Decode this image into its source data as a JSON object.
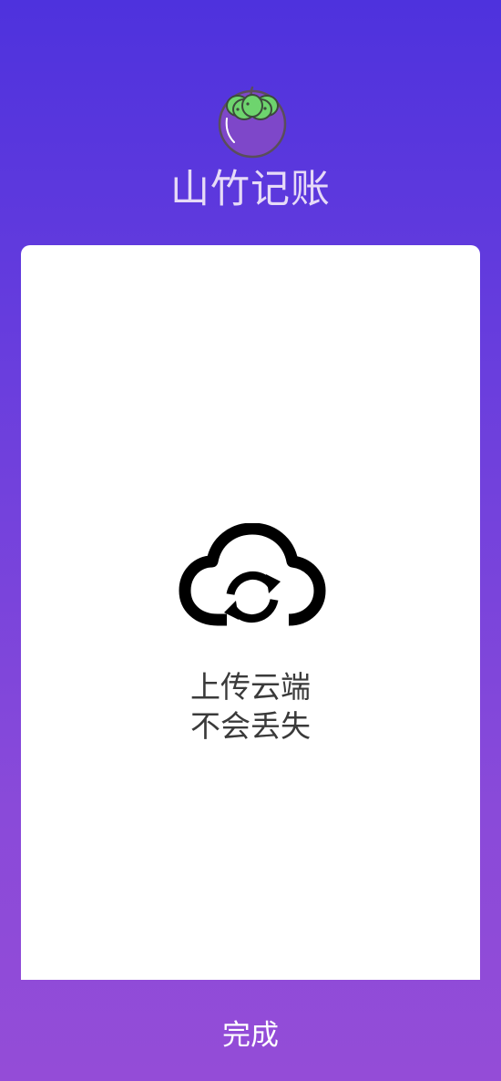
{
  "app": {
    "title": "山竹记账",
    "logo_icon": "mangosteen-icon"
  },
  "feature": {
    "icon": "cloud-sync-icon",
    "line1": "上传云端",
    "line2": "不会丢失"
  },
  "footer": {
    "done_label": "完成"
  },
  "colors": {
    "gradient_top": "#4E32DD",
    "gradient_bottom": "#944CD7",
    "title": "#E6DAF7",
    "card": "#FFFFFF",
    "text": "#3A3A3A",
    "button_text": "#FFFFFF"
  }
}
